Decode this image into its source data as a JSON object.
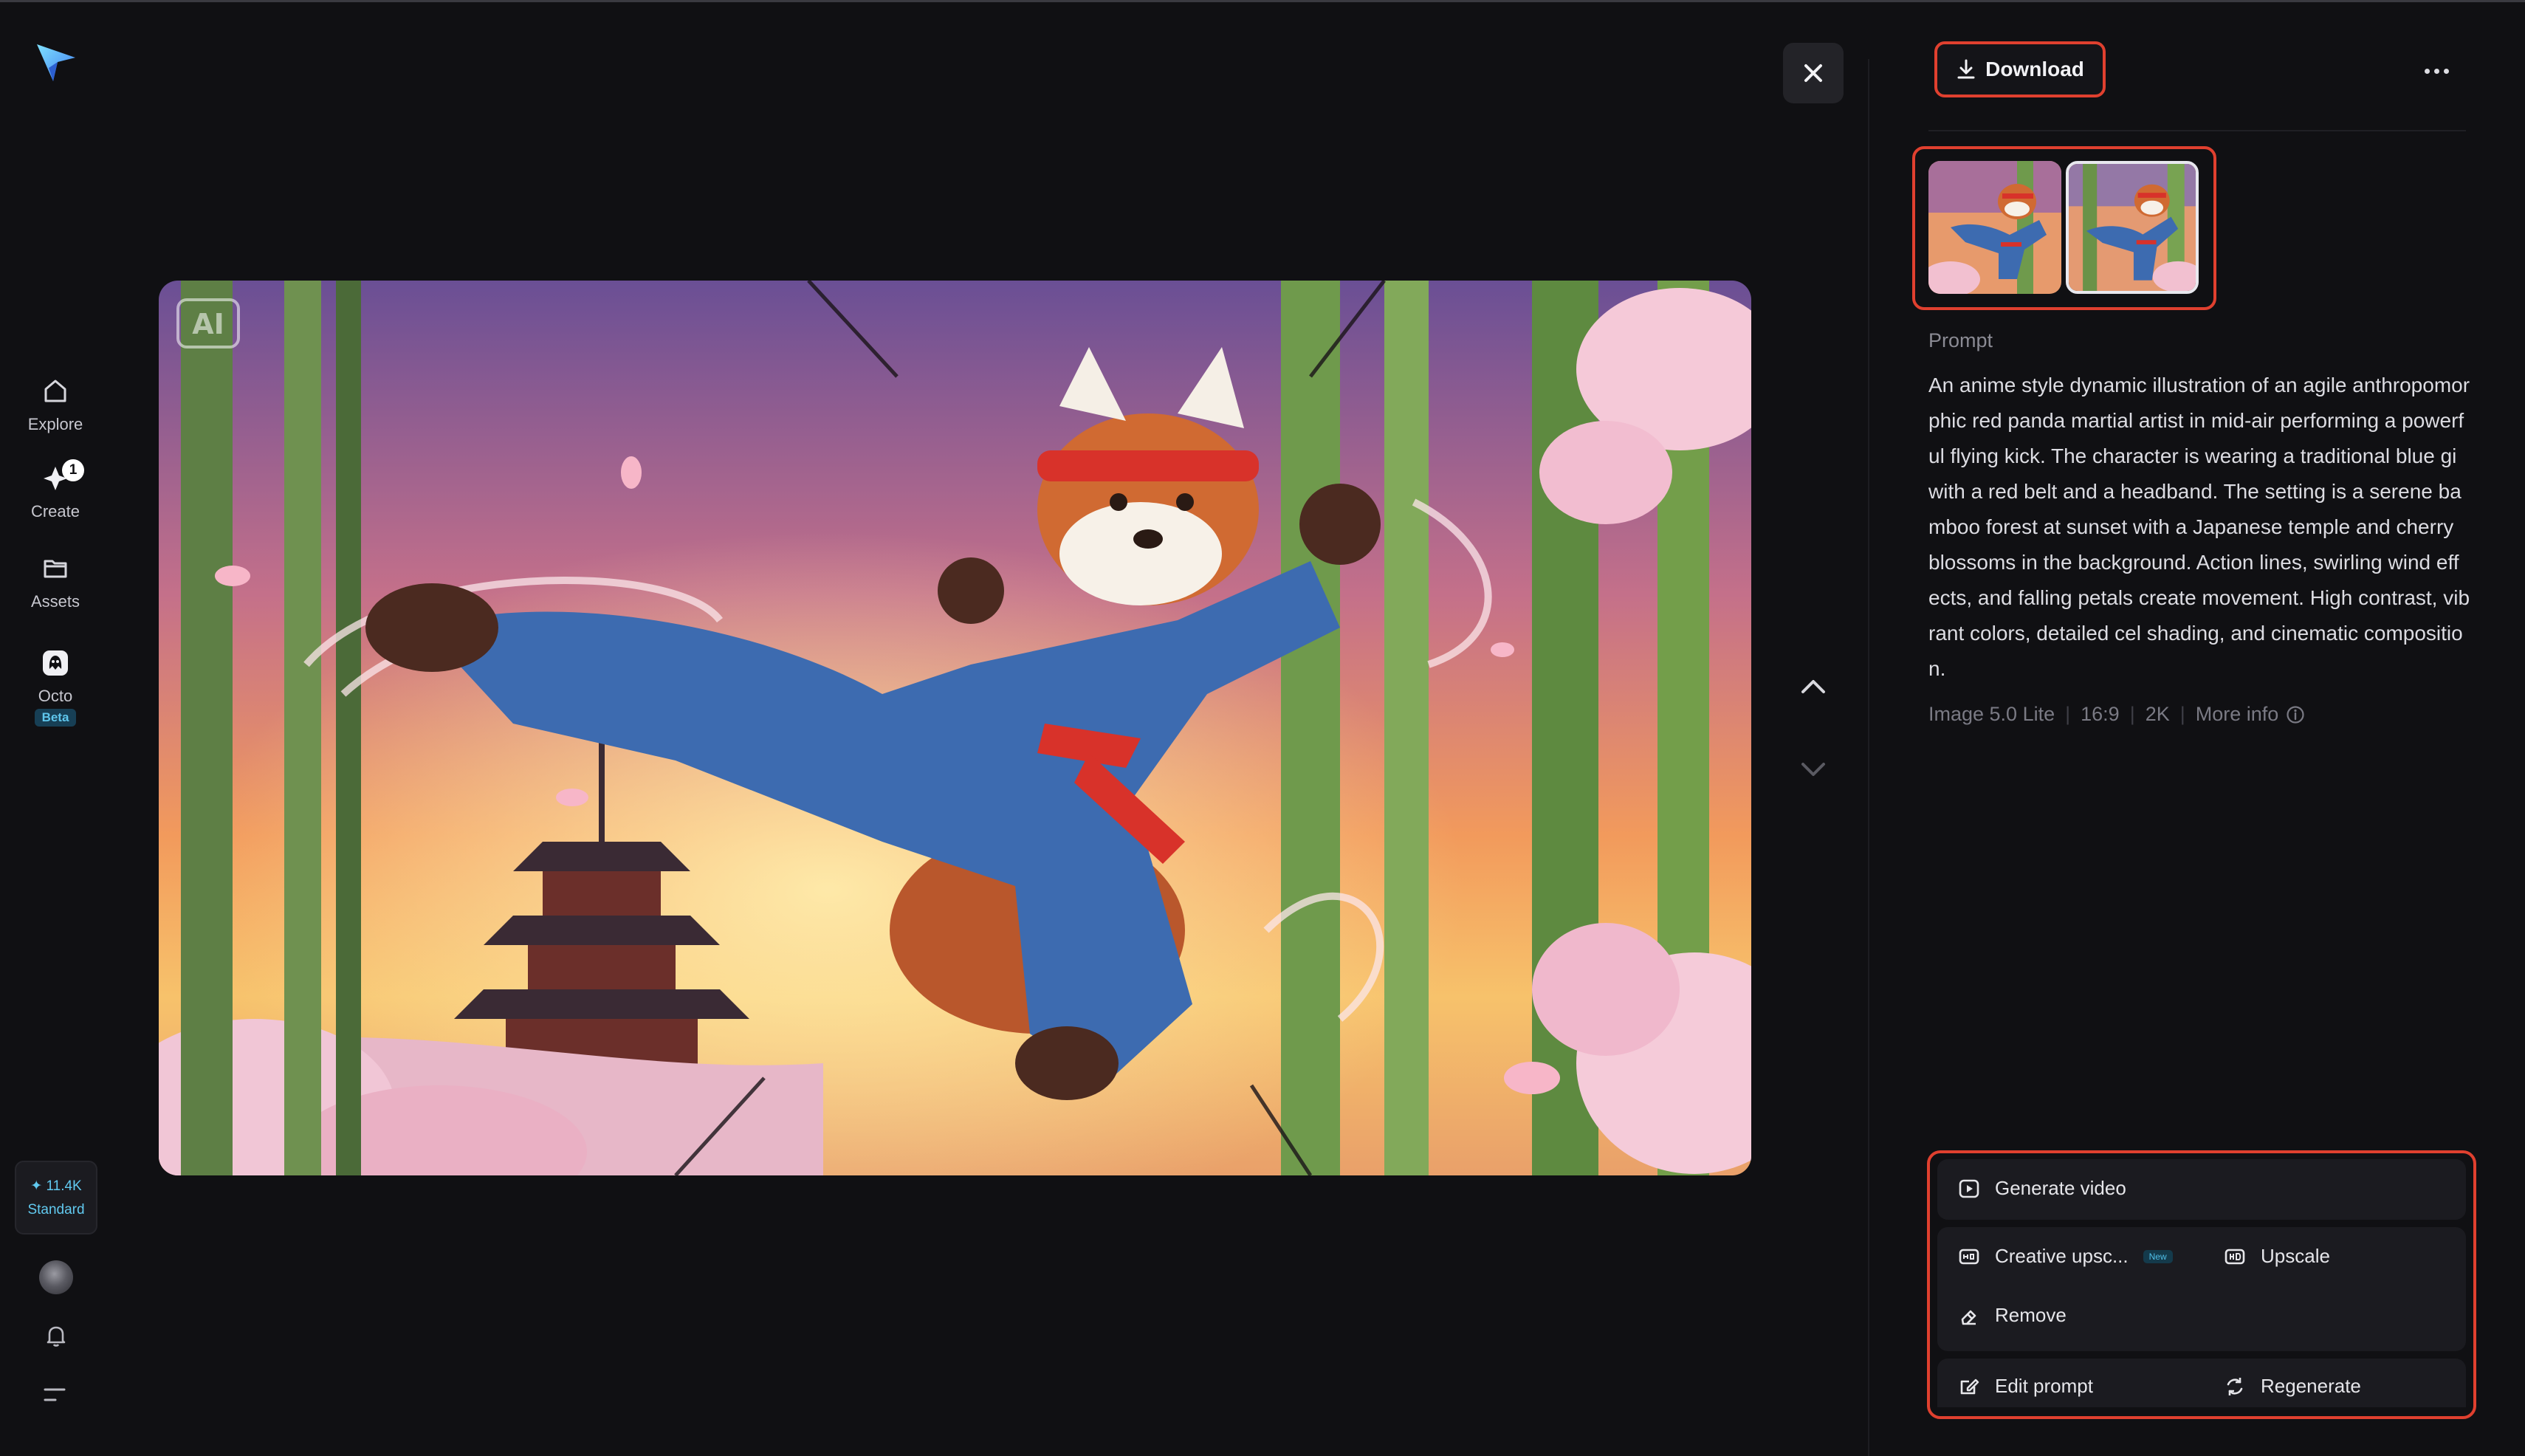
{
  "sidebar": {
    "nav": [
      {
        "label": "Explore",
        "icon": "home-icon"
      },
      {
        "label": "Create",
        "icon": "create-icon",
        "badge": "1"
      },
      {
        "label": "Assets",
        "icon": "folder-icon"
      },
      {
        "label": "Octo",
        "icon": "octo-icon",
        "tag": "Beta"
      }
    ],
    "credits": {
      "amount": "✦ 11.4K",
      "plan": "Standard"
    }
  },
  "viewer": {
    "watermark": "AI",
    "close_icon": "close-icon",
    "prev_icon": "chevron-up-icon",
    "next_icon": "chevron-down-icon"
  },
  "panel": {
    "download_label": "Download",
    "prompt_label": "Prompt",
    "prompt_text": "An anime style dynamic illustration of an agile anthropomorphic red panda martial artist in mid-air performing a powerful flying kick. The character is wearing a traditional blue gi with a red belt and a headband. The setting is a serene bamboo forest at sunset with a Japanese temple and cherry blossoms in the background. Action lines, swirling wind effects, and falling petals create movement. High contrast, vibrant colors, detailed cel shading, and cinematic composition.",
    "meta": {
      "model": "Image 5.0 Lite",
      "ratio": "16:9",
      "resolution": "2K",
      "more_info": "More info"
    },
    "actions": {
      "generate_video": "Generate video",
      "creative_upscale": "Creative upsc...",
      "new_badge": "New",
      "upscale": "Upscale",
      "remove": "Remove",
      "edit_prompt": "Edit prompt",
      "regenerate": "Regenerate"
    }
  },
  "colors": {
    "background": "#101013",
    "highlight": "#e0402f",
    "accent": "#61c9ef",
    "card": "#1b1b20"
  }
}
